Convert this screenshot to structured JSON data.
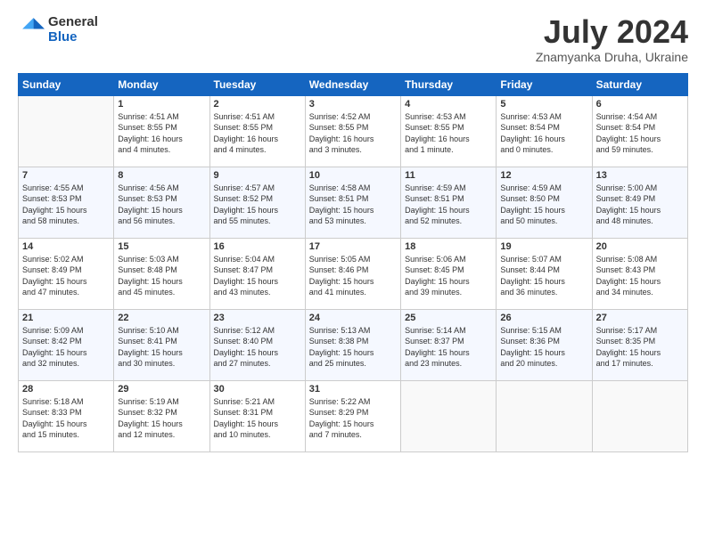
{
  "header": {
    "logo_line1": "General",
    "logo_line2": "Blue",
    "month": "July 2024",
    "location": "Znamyanka Druha, Ukraine"
  },
  "weekdays": [
    "Sunday",
    "Monday",
    "Tuesday",
    "Wednesday",
    "Thursday",
    "Friday",
    "Saturday"
  ],
  "weeks": [
    [
      {
        "day": "",
        "info": ""
      },
      {
        "day": "1",
        "info": "Sunrise: 4:51 AM\nSunset: 8:55 PM\nDaylight: 16 hours\nand 4 minutes."
      },
      {
        "day": "2",
        "info": "Sunrise: 4:51 AM\nSunset: 8:55 PM\nDaylight: 16 hours\nand 4 minutes."
      },
      {
        "day": "3",
        "info": "Sunrise: 4:52 AM\nSunset: 8:55 PM\nDaylight: 16 hours\nand 3 minutes."
      },
      {
        "day": "4",
        "info": "Sunrise: 4:53 AM\nSunset: 8:55 PM\nDaylight: 16 hours\nand 1 minute."
      },
      {
        "day": "5",
        "info": "Sunrise: 4:53 AM\nSunset: 8:54 PM\nDaylight: 16 hours\nand 0 minutes."
      },
      {
        "day": "6",
        "info": "Sunrise: 4:54 AM\nSunset: 8:54 PM\nDaylight: 15 hours\nand 59 minutes."
      }
    ],
    [
      {
        "day": "7",
        "info": "Sunrise: 4:55 AM\nSunset: 8:53 PM\nDaylight: 15 hours\nand 58 minutes."
      },
      {
        "day": "8",
        "info": "Sunrise: 4:56 AM\nSunset: 8:53 PM\nDaylight: 15 hours\nand 56 minutes."
      },
      {
        "day": "9",
        "info": "Sunrise: 4:57 AM\nSunset: 8:52 PM\nDaylight: 15 hours\nand 55 minutes."
      },
      {
        "day": "10",
        "info": "Sunrise: 4:58 AM\nSunset: 8:51 PM\nDaylight: 15 hours\nand 53 minutes."
      },
      {
        "day": "11",
        "info": "Sunrise: 4:59 AM\nSunset: 8:51 PM\nDaylight: 15 hours\nand 52 minutes."
      },
      {
        "day": "12",
        "info": "Sunrise: 4:59 AM\nSunset: 8:50 PM\nDaylight: 15 hours\nand 50 minutes."
      },
      {
        "day": "13",
        "info": "Sunrise: 5:00 AM\nSunset: 8:49 PM\nDaylight: 15 hours\nand 48 minutes."
      }
    ],
    [
      {
        "day": "14",
        "info": "Sunrise: 5:02 AM\nSunset: 8:49 PM\nDaylight: 15 hours\nand 47 minutes."
      },
      {
        "day": "15",
        "info": "Sunrise: 5:03 AM\nSunset: 8:48 PM\nDaylight: 15 hours\nand 45 minutes."
      },
      {
        "day": "16",
        "info": "Sunrise: 5:04 AM\nSunset: 8:47 PM\nDaylight: 15 hours\nand 43 minutes."
      },
      {
        "day": "17",
        "info": "Sunrise: 5:05 AM\nSunset: 8:46 PM\nDaylight: 15 hours\nand 41 minutes."
      },
      {
        "day": "18",
        "info": "Sunrise: 5:06 AM\nSunset: 8:45 PM\nDaylight: 15 hours\nand 39 minutes."
      },
      {
        "day": "19",
        "info": "Sunrise: 5:07 AM\nSunset: 8:44 PM\nDaylight: 15 hours\nand 36 minutes."
      },
      {
        "day": "20",
        "info": "Sunrise: 5:08 AM\nSunset: 8:43 PM\nDaylight: 15 hours\nand 34 minutes."
      }
    ],
    [
      {
        "day": "21",
        "info": "Sunrise: 5:09 AM\nSunset: 8:42 PM\nDaylight: 15 hours\nand 32 minutes."
      },
      {
        "day": "22",
        "info": "Sunrise: 5:10 AM\nSunset: 8:41 PM\nDaylight: 15 hours\nand 30 minutes."
      },
      {
        "day": "23",
        "info": "Sunrise: 5:12 AM\nSunset: 8:40 PM\nDaylight: 15 hours\nand 27 minutes."
      },
      {
        "day": "24",
        "info": "Sunrise: 5:13 AM\nSunset: 8:38 PM\nDaylight: 15 hours\nand 25 minutes."
      },
      {
        "day": "25",
        "info": "Sunrise: 5:14 AM\nSunset: 8:37 PM\nDaylight: 15 hours\nand 23 minutes."
      },
      {
        "day": "26",
        "info": "Sunrise: 5:15 AM\nSunset: 8:36 PM\nDaylight: 15 hours\nand 20 minutes."
      },
      {
        "day": "27",
        "info": "Sunrise: 5:17 AM\nSunset: 8:35 PM\nDaylight: 15 hours\nand 17 minutes."
      }
    ],
    [
      {
        "day": "28",
        "info": "Sunrise: 5:18 AM\nSunset: 8:33 PM\nDaylight: 15 hours\nand 15 minutes."
      },
      {
        "day": "29",
        "info": "Sunrise: 5:19 AM\nSunset: 8:32 PM\nDaylight: 15 hours\nand 12 minutes."
      },
      {
        "day": "30",
        "info": "Sunrise: 5:21 AM\nSunset: 8:31 PM\nDaylight: 15 hours\nand 10 minutes."
      },
      {
        "day": "31",
        "info": "Sunrise: 5:22 AM\nSunset: 8:29 PM\nDaylight: 15 hours\nand 7 minutes."
      },
      {
        "day": "",
        "info": ""
      },
      {
        "day": "",
        "info": ""
      },
      {
        "day": "",
        "info": ""
      }
    ]
  ]
}
